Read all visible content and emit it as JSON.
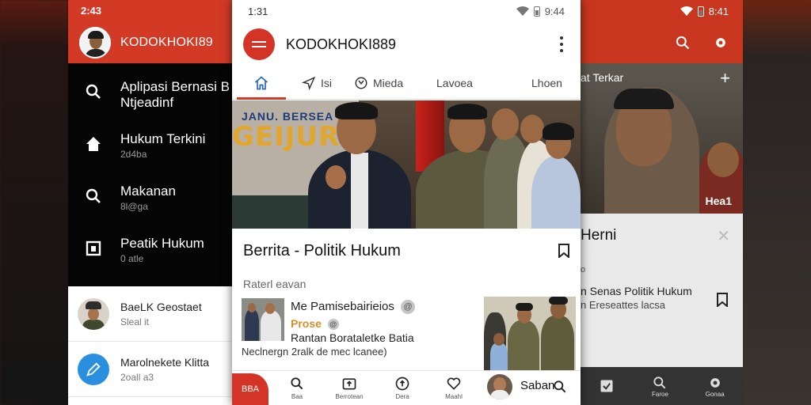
{
  "left_phone": {
    "status_time": "2:43",
    "username": "KODOKHOKI89",
    "drawer_items": [
      {
        "title": "Aplipasi Bernasi B",
        "subtitle": "Ntjeadinf",
        "icon": "search-icon"
      },
      {
        "title": "Hukum Terkini",
        "subtitle": "2d4ba",
        "icon": "home-icon"
      },
      {
        "title": "Makanan",
        "subtitle": "8l@ga",
        "icon": "search-icon"
      },
      {
        "title": "Peatik Hukum",
        "subtitle": "0 atle",
        "icon": "bookmark-square-icon"
      }
    ],
    "list_rows": [
      {
        "title": "BaeLK Geostaet",
        "subtitle": "Sleal it"
      },
      {
        "title": "Marolnekete Klitta",
        "subtitle": "2oall a3"
      }
    ]
  },
  "center_phone": {
    "status_time": "1:31",
    "status_right": "9:44",
    "app_title": "KODOKHOKI889",
    "tabs": [
      {
        "label": "",
        "icon": "home-icon",
        "active": true
      },
      {
        "label": "Isi",
        "icon": "send-icon"
      },
      {
        "label": "Mieda",
        "icon": "clock-icon"
      },
      {
        "label": "Lavoea",
        "icon": ""
      },
      {
        "label": "Lhoen",
        "icon": ""
      }
    ],
    "hero_banner": {
      "line1": "JANU. BERSEA",
      "line2": "GEIJURN"
    },
    "headline": "Berrita - Politik Hukum",
    "section_label": "Raterl eavan",
    "card": {
      "title": "Me Pamisebairieios",
      "badge": "@",
      "sub": "Prose",
      "line": "Rantan Borataletke Batia",
      "footer": "Neclnergn 2ralk de mec lcanee)"
    },
    "bottom_nav": [
      {
        "label": "Baa",
        "icon": "search-icon"
      },
      {
        "label": "Berrotean",
        "icon": "upload-icon"
      },
      {
        "label": "Dera",
        "icon": "arrow-up-circle-icon"
      },
      {
        "label": "Maahl",
        "icon": "heart-icon"
      }
    ],
    "fab_label": "BBA",
    "profile_label": "Saban",
    "accent_color": "#d43425"
  },
  "right_phone": {
    "status_time": "8:41",
    "photo_label": "at Terkar",
    "photo_tag": "Hea1",
    "title": "Herni",
    "small_label": "o",
    "story_title": "n Senas Politik Hukum",
    "story_sub": "n Ereseattes lacsa",
    "bottom_labels": [
      "",
      "Faroe",
      "Gonaa"
    ]
  }
}
